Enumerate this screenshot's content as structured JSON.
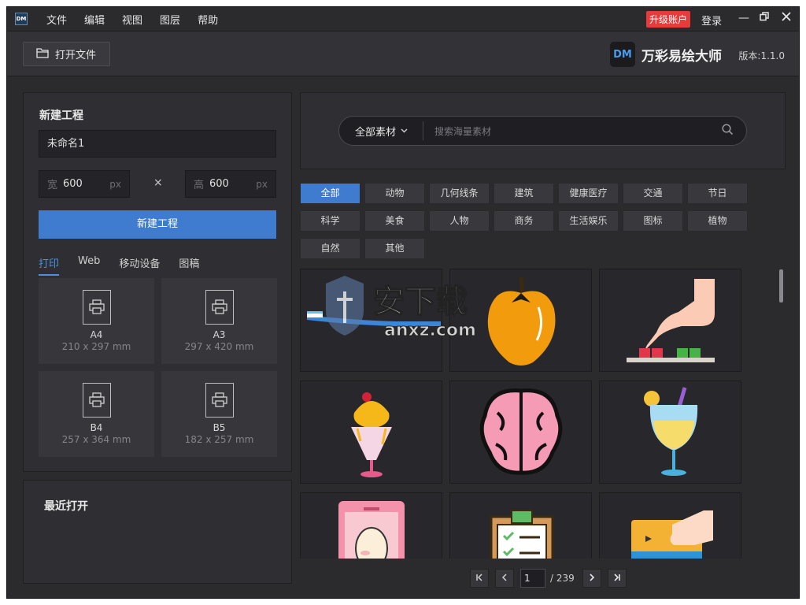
{
  "app": {
    "logo_text": "DM"
  },
  "menu": [
    "文件",
    "编辑",
    "视图",
    "图层",
    "帮助"
  ],
  "account": {
    "upgrade": "升级账户",
    "login": "登录"
  },
  "toolbar": {
    "open_file": "打开文件",
    "brand_logo": "DM",
    "brand_name": "万彩易绘大师",
    "version": "版本:1.1.0"
  },
  "new_project": {
    "title": "新建工程",
    "name_value": "未命名1",
    "width_prefix": "宽",
    "width_value": "600",
    "width_unit": "px",
    "times": "×",
    "height_prefix": "高",
    "height_value": "600",
    "height_unit": "px",
    "create_button": "新建工程",
    "tabs": [
      "打印",
      "Web",
      "移动设备",
      "图稿"
    ],
    "active_tab": "打印",
    "presets": [
      {
        "name": "A4",
        "size": "210 x 297 mm"
      },
      {
        "name": "A3",
        "size": "297 x 420 mm"
      },
      {
        "name": "B4",
        "size": "257 x 364 mm"
      },
      {
        "name": "B5",
        "size": "182 x 257 mm"
      }
    ]
  },
  "recent": {
    "title": "最近打开"
  },
  "search": {
    "scope": "全部素材",
    "placeholder": "搜索海量素材"
  },
  "categories": [
    "全部",
    "动物",
    "几何线条",
    "建筑",
    "健康医疗",
    "交通",
    "节日",
    "科学",
    "美食",
    "人物",
    "商务",
    "生活娱乐",
    "图标",
    "植物",
    "自然",
    "其他"
  ],
  "active_category": "全部",
  "gallery": [
    "toothbrush",
    "pumpkin",
    "finger-press",
    "ice-cream-sundae",
    "brain",
    "cocktail",
    "card-portrait",
    "clipboard-checklist",
    "card-hand"
  ],
  "watermark": {
    "text": "安下载",
    "sub": "anxz.com"
  },
  "pager": {
    "current": "1",
    "total": "/ 239"
  },
  "colors": {
    "accent": "#3f7bcf",
    "upgrade": "#e53b3b",
    "bg": "#2b2a2d"
  }
}
